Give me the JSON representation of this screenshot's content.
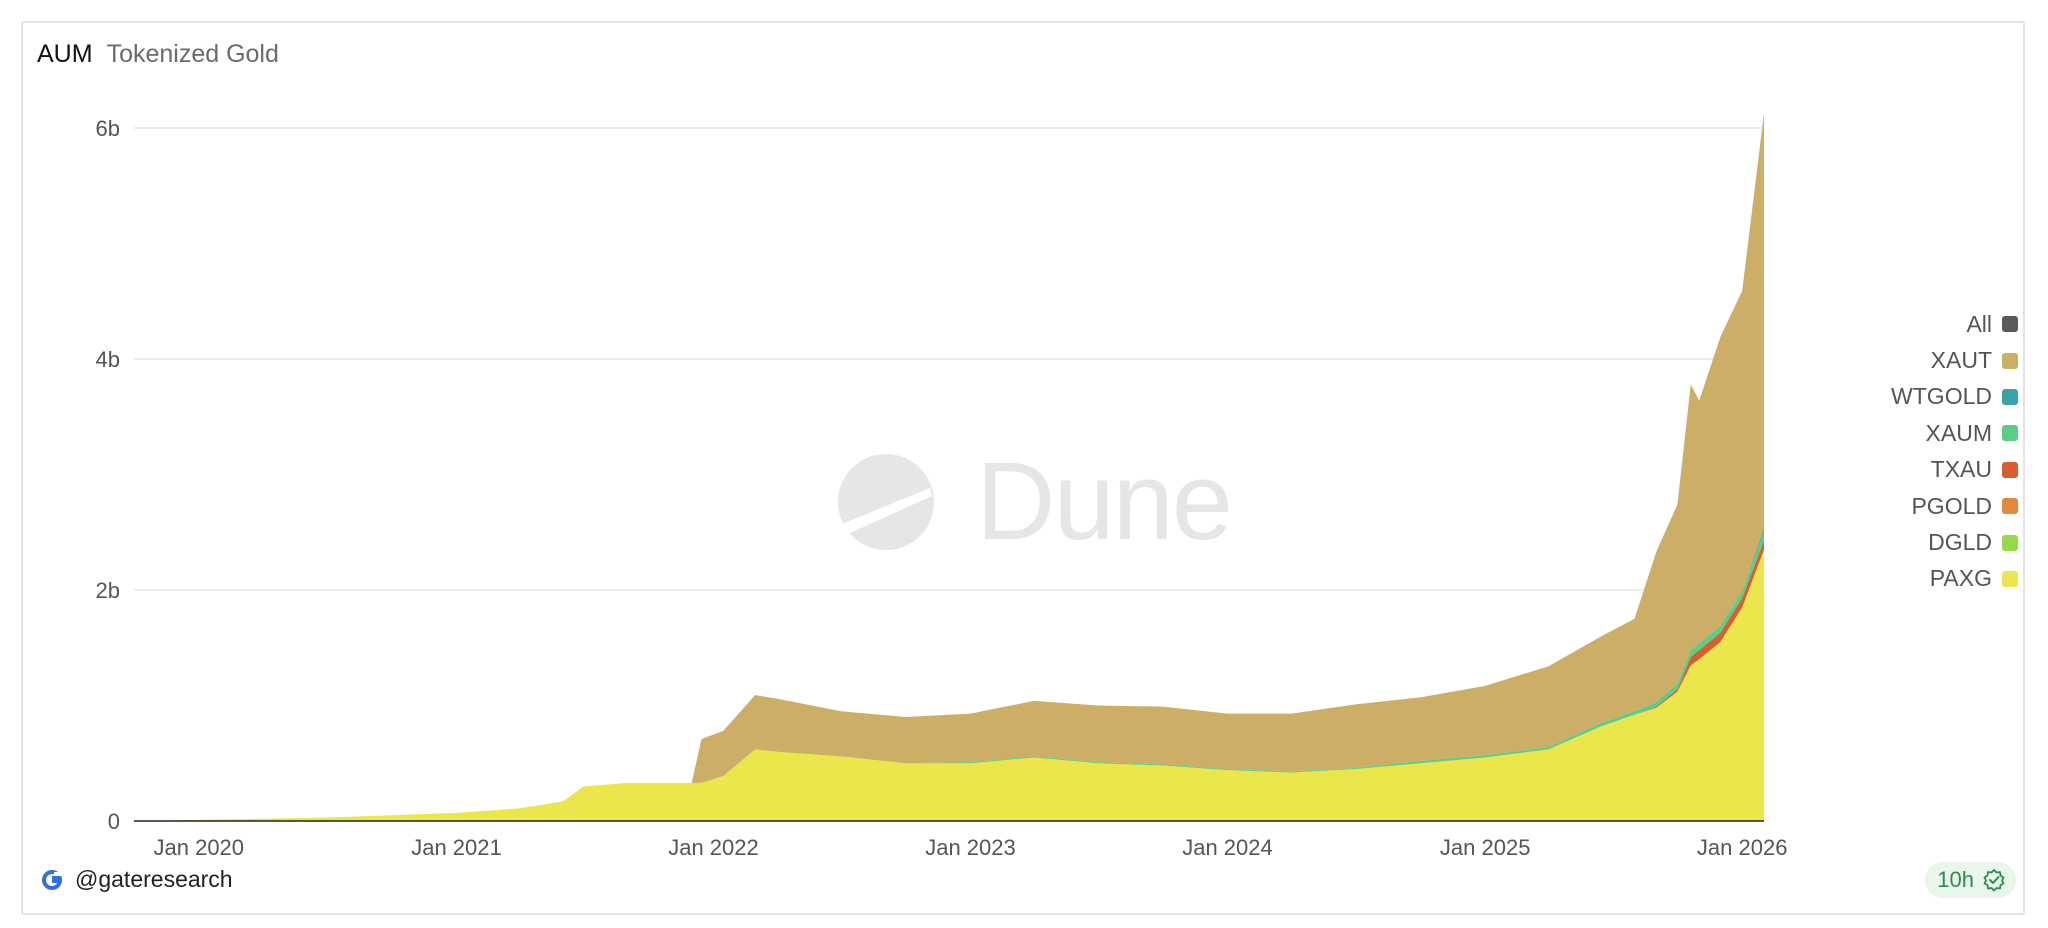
{
  "header": {
    "title": "AUM",
    "subtitle": "Tokenized Gold"
  },
  "watermark": {
    "text": "Dune"
  },
  "footer": {
    "handle": "@gateresearch",
    "badge": "10h"
  },
  "chart_data": {
    "type": "area",
    "stacked": true,
    "x_axis": {
      "type": "date",
      "ticks": [
        "Jan 2020",
        "Jan 2021",
        "Jan 2022",
        "Jan 2023",
        "Jan 2024",
        "Jan 2025",
        "Jan 2026"
      ]
    },
    "y_axis": {
      "ylim": [
        0,
        6000000000
      ],
      "ticks": [
        {
          "value": 0,
          "label": "0"
        },
        {
          "value": 2000000000,
          "label": "2b"
        },
        {
          "value": 4000000000,
          "label": "4b"
        },
        {
          "value": 6000000000,
          "label": "6b"
        }
      ]
    },
    "grid": true,
    "legend_position": "right",
    "legend": [
      {
        "name": "All",
        "color": "#5a5a5a"
      },
      {
        "name": "XAUT",
        "color": "#ccae67"
      },
      {
        "name": "WTGOLD",
        "color": "#3aa3a8"
      },
      {
        "name": "XAUM",
        "color": "#5ccd86"
      },
      {
        "name": "TXAU",
        "color": "#d65f2c"
      },
      {
        "name": "PGOLD",
        "color": "#e4883a"
      },
      {
        "name": "DGLD",
        "color": "#96d94a"
      },
      {
        "name": "PAXG",
        "color": "#ebe64b"
      }
    ],
    "x": [
      "2019-10-01",
      "2020-01-01",
      "2020-04-01",
      "2020-07-01",
      "2020-10-01",
      "2021-01-01",
      "2021-04-01",
      "2021-06-01",
      "2021-07-01",
      "2021-09-01",
      "2021-12-01",
      "2021-12-15",
      "2022-01-15",
      "2022-03-01",
      "2022-04-01",
      "2022-07-01",
      "2022-10-01",
      "2023-01-01",
      "2023-04-01",
      "2023-07-01",
      "2023-10-01",
      "2024-01-01",
      "2024-04-01",
      "2024-07-01",
      "2024-10-01",
      "2025-01-01",
      "2025-04-01",
      "2025-06-15",
      "2025-08-01",
      "2025-09-01",
      "2025-10-01",
      "2025-10-20",
      "2025-11-01",
      "2025-12-01",
      "2026-01-01",
      "2026-02-01"
    ],
    "series": [
      {
        "name": "PAXG",
        "values": [
          0,
          0.01,
          0.02,
          0.03,
          0.05,
          0.07,
          0.11,
          0.17,
          0.3,
          0.33,
          0.33,
          0.33,
          0.39,
          0.62,
          0.6,
          0.56,
          0.5,
          0.5,
          0.55,
          0.5,
          0.48,
          0.44,
          0.42,
          0.45,
          0.5,
          0.55,
          0.62,
          0.82,
          0.92,
          0.98,
          1.12,
          1.35,
          1.4,
          1.55,
          1.85,
          2.35
        ]
      },
      {
        "name": "DGLD",
        "values": [
          0,
          0,
          0,
          0,
          0,
          0,
          0,
          0,
          0,
          0,
          0,
          0,
          0,
          0,
          0,
          0,
          0,
          0,
          0,
          0,
          0,
          0,
          0,
          0,
          0,
          0,
          0,
          0,
          0,
          0,
          0,
          0,
          0,
          0,
          0,
          0
        ]
      },
      {
        "name": "PGOLD",
        "values": [
          0,
          0,
          0,
          0,
          0,
          0,
          0,
          0,
          0,
          0,
          0,
          0,
          0,
          0,
          0,
          0,
          0,
          0,
          0,
          0,
          0,
          0,
          0,
          0,
          0,
          0,
          0,
          0,
          0,
          0,
          0,
          0,
          0,
          0,
          0,
          0
        ]
      },
      {
        "name": "TXAU",
        "values": [
          0,
          0,
          0,
          0,
          0,
          0,
          0,
          0,
          0,
          0,
          0,
          0,
          0,
          0,
          0,
          0,
          0,
          0,
          0,
          0,
          0,
          0,
          0,
          0,
          0,
          0,
          0,
          0,
          0,
          0.01,
          0.02,
          0.07,
          0.08,
          0.08,
          0.08,
          0.08
        ]
      },
      {
        "name": "XAUM",
        "values": [
          0,
          0,
          0,
          0,
          0,
          0,
          0,
          0,
          0,
          0,
          0,
          0,
          0,
          0,
          0,
          0,
          0,
          0.01,
          0.01,
          0.01,
          0.01,
          0.01,
          0.01,
          0.01,
          0.02,
          0.02,
          0.02,
          0.03,
          0.03,
          0.04,
          0.05,
          0.06,
          0.06,
          0.06,
          0.06,
          0.07
        ]
      },
      {
        "name": "WTGOLD",
        "values": [
          0,
          0,
          0,
          0,
          0,
          0,
          0,
          0,
          0,
          0,
          0,
          0,
          0,
          0,
          0,
          0,
          0,
          0,
          0,
          0,
          0,
          0,
          0,
          0,
          0,
          0,
          0,
          0,
          0,
          0,
          0,
          0,
          0,
          0,
          0,
          0.03
        ]
      },
      {
        "name": "XAUT",
        "values": [
          0,
          0,
          0,
          0,
          0,
          0,
          0,
          0,
          0,
          0,
          0,
          0.38,
          0.39,
          0.47,
          0.46,
          0.39,
          0.4,
          0.42,
          0.48,
          0.49,
          0.5,
          0.48,
          0.5,
          0.55,
          0.55,
          0.6,
          0.7,
          0.75,
          0.8,
          1.3,
          1.55,
          2.3,
          2.1,
          2.5,
          2.6,
          3.6
        ]
      }
    ],
    "value_unit_note_removed": true
  }
}
